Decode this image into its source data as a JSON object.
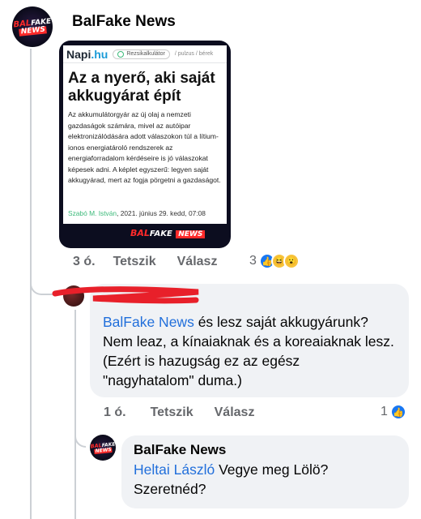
{
  "post": {
    "author": "BalFake News",
    "logo_top": "BAL",
    "logo_script": "FAKE",
    "logo_bottom": "NEWS",
    "shared_article": {
      "site_name_main": "Napi",
      "site_name_tld": ".hu",
      "tag": "Rezsikalkulátor",
      "breadcrumbs": "/ pulzus / bérek",
      "headline": "Az a nyerő, aki saját akkugyárat épít",
      "excerpt": "Az akkumulátorgyár az új olaj a nemzeti gazdaságok számára, mivel az autóipar elektronizálódására adott válaszokon túl a lítium-ionos energiatároló rendszerek az energiaforradalom kérdéseire is jó válaszokat képesek adni. A képlet egyszerű: legyen saját akkugyárad, mert az fogja pörgetni a gazdaságot.",
      "byline_author": "Szabó M. István",
      "byline_date": ", 2021. június 29. kedd, 07:08"
    },
    "time": "3 ó.",
    "like_label": "Tetszik",
    "reply_label": "Válasz",
    "reaction_count": "3",
    "reactions": [
      "like-icon",
      "haha-icon",
      "wow-icon"
    ]
  },
  "comment": {
    "mention": "BalFake News",
    "text": " és lesz saját akkugyárunk? Nem leaz, a kínaiaknak és a koreaiaknak lesz. (Ezért is hazugság ez az egész \"nagyhatalom\" duma.)",
    "time": "1 ó.",
    "like_label": "Tetszik",
    "reply_label": "Válasz",
    "reaction_count": "1",
    "reactions": [
      "like-icon"
    ]
  },
  "reply": {
    "author": "BalFake News",
    "mention": "Heltai László",
    "text": " Vegye meg Lölö? Szeretnéd?"
  },
  "colors": {
    "link_blue": "#216fdb",
    "like_blue": "#1877f2",
    "bubble_gray": "#f0f2f5",
    "meta_gray": "#65676b",
    "redaction_red": "#e8202a"
  }
}
